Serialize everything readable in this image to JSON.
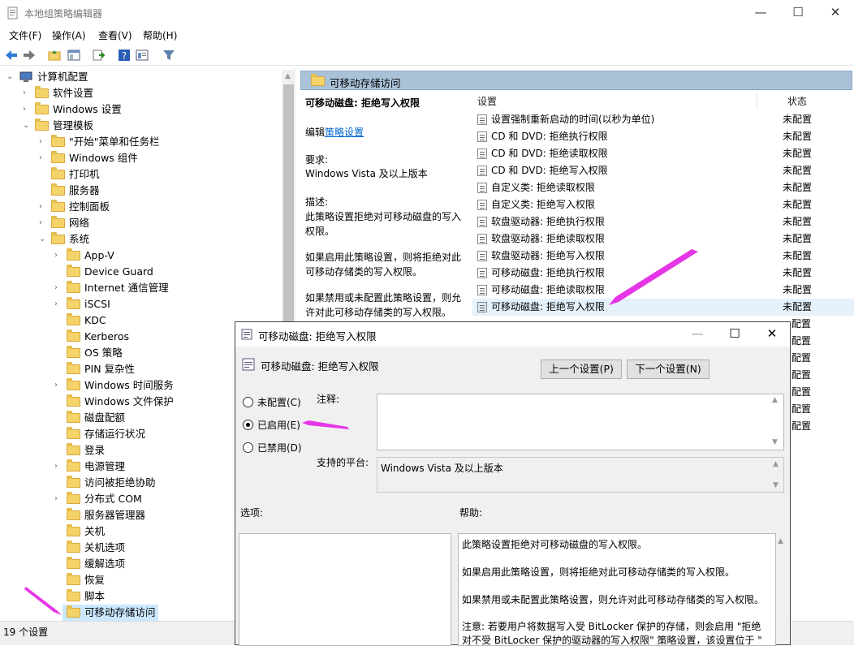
{
  "window": {
    "title": "本地组策略编辑器",
    "minimize": "—",
    "maximize": "☐",
    "close": "✕"
  },
  "menu": [
    "文件(F)",
    "操作(A)",
    "查看(V)",
    "帮助(H)"
  ],
  "tree": {
    "root": "计算机配置",
    "items": [
      {
        "label": "软件设置",
        "lvl": 1,
        "chev": "›"
      },
      {
        "label": "Windows 设置",
        "lvl": 1,
        "chev": "›"
      },
      {
        "label": "管理模板",
        "lvl": 1,
        "chev": "⌄"
      },
      {
        "label": "\"开始\"菜单和任务栏",
        "lvl": 2,
        "chev": "›"
      },
      {
        "label": "Windows 组件",
        "lvl": 2,
        "chev": "›"
      },
      {
        "label": "打印机",
        "lvl": 2,
        "chev": ""
      },
      {
        "label": "服务器",
        "lvl": 2,
        "chev": ""
      },
      {
        "label": "控制面板",
        "lvl": 2,
        "chev": "›"
      },
      {
        "label": "网络",
        "lvl": 2,
        "chev": "›"
      },
      {
        "label": "系统",
        "lvl": 2,
        "chev": "⌄"
      },
      {
        "label": "App-V",
        "lvl": 3,
        "chev": "›"
      },
      {
        "label": "Device Guard",
        "lvl": 3,
        "chev": ""
      },
      {
        "label": "Internet 通信管理",
        "lvl": 3,
        "chev": "›"
      },
      {
        "label": "iSCSI",
        "lvl": 3,
        "chev": "›"
      },
      {
        "label": "KDC",
        "lvl": 3,
        "chev": ""
      },
      {
        "label": "Kerberos",
        "lvl": 3,
        "chev": ""
      },
      {
        "label": "OS 策略",
        "lvl": 3,
        "chev": ""
      },
      {
        "label": "PIN 复杂性",
        "lvl": 3,
        "chev": ""
      },
      {
        "label": "Windows 时间服务",
        "lvl": 3,
        "chev": "›"
      },
      {
        "label": "Windows 文件保护",
        "lvl": 3,
        "chev": ""
      },
      {
        "label": "磁盘配额",
        "lvl": 3,
        "chev": ""
      },
      {
        "label": "存储运行状况",
        "lvl": 3,
        "chev": ""
      },
      {
        "label": "登录",
        "lvl": 3,
        "chev": ""
      },
      {
        "label": "电源管理",
        "lvl": 3,
        "chev": "›"
      },
      {
        "label": "访问被拒绝协助",
        "lvl": 3,
        "chev": ""
      },
      {
        "label": "分布式 COM",
        "lvl": 3,
        "chev": "›"
      },
      {
        "label": "服务器管理器",
        "lvl": 3,
        "chev": ""
      },
      {
        "label": "关机",
        "lvl": 3,
        "chev": ""
      },
      {
        "label": "关机选项",
        "lvl": 3,
        "chev": ""
      },
      {
        "label": "缓解选项",
        "lvl": 3,
        "chev": ""
      },
      {
        "label": "恢复",
        "lvl": 3,
        "chev": ""
      },
      {
        "label": "脚本",
        "lvl": 3,
        "chev": ""
      },
      {
        "label": "可移动存储访问",
        "lvl": 3,
        "chev": "",
        "selected": true
      }
    ]
  },
  "right_header": "可移动存储访问",
  "desc": {
    "title": "可移动磁盘: 拒绝写入权限",
    "edit_prefix": "编辑",
    "edit_link": "策略设置",
    "req_label": "要求:",
    "req_value": "Windows Vista 及以上版本",
    "desc_label": "描述:",
    "p1": "此策略设置拒绝对可移动磁盘的写入权限。",
    "p2": "如果启用此策略设置，则将拒绝对此可移动存储类的写入权限。",
    "p3": "如果禁用或未配置此策略设置，则允许对此可移动存储类的写入权限。"
  },
  "list": {
    "col_setting": "设置",
    "col_state": "状态",
    "rows": [
      {
        "name": "设置强制重新启动的时间(以秒为单位)",
        "state": "未配置"
      },
      {
        "name": "CD 和 DVD: 拒绝执行权限",
        "state": "未配置"
      },
      {
        "name": "CD 和 DVD: 拒绝读取权限",
        "state": "未配置"
      },
      {
        "name": "CD 和 DVD: 拒绝写入权限",
        "state": "未配置"
      },
      {
        "name": "自定义类: 拒绝读取权限",
        "state": "未配置"
      },
      {
        "name": "自定义类: 拒绝写入权限",
        "state": "未配置"
      },
      {
        "name": "软盘驱动器: 拒绝执行权限",
        "state": "未配置"
      },
      {
        "name": "软盘驱动器: 拒绝读取权限",
        "state": "未配置"
      },
      {
        "name": "软盘驱动器: 拒绝写入权限",
        "state": "未配置"
      },
      {
        "name": "可移动磁盘: 拒绝执行权限",
        "state": "未配置"
      },
      {
        "name": "可移动磁盘: 拒绝读取权限",
        "state": "未配置"
      },
      {
        "name": "可移动磁盘: 拒绝写入权限",
        "state": "未配置",
        "highlight": true
      }
    ],
    "hidden_states": [
      "配置",
      "配置",
      "配置",
      "配置",
      "配置",
      "配置",
      "配置"
    ]
  },
  "status": "19 个设置",
  "dialog": {
    "title": "可移动磁盘: 拒绝写入权限",
    "subtitle": "可移动磁盘: 拒绝写入权限",
    "prev_btn": "上一个设置(P)",
    "next_btn": "下一个设置(N)",
    "opt_notconfigured": "未配置(C)",
    "opt_enabled": "已启用(E)",
    "opt_disabled": "已禁用(D)",
    "selected_option": "已启用(E)",
    "comment_label": "注释:",
    "comment_value": "",
    "platform_label": "支持的平台:",
    "platform_value": "Windows Vista 及以上版本",
    "options_label": "选项:",
    "help_label": "帮助:",
    "help_p1": "此策略设置拒绝对可移动磁盘的写入权限。",
    "help_p2": "如果启用此策略设置，则将拒绝对此可移动存储类的写入权限。",
    "help_p3": "如果禁用或未配置此策略设置，则允许对此可移动存储类的写入权限。",
    "help_p4": "注意: 若要用户将数据写入受 BitLocker 保护的存储，则会启用 \"拒绝对不受 BitLocker 保护的驱动器的写入权限\" 策略设置，该设置位于 \""
  },
  "accent": {
    "arrow": "#e635e6",
    "selection": "#cce8ff",
    "header": "#a9c2d8",
    "link": "#0066cc"
  }
}
